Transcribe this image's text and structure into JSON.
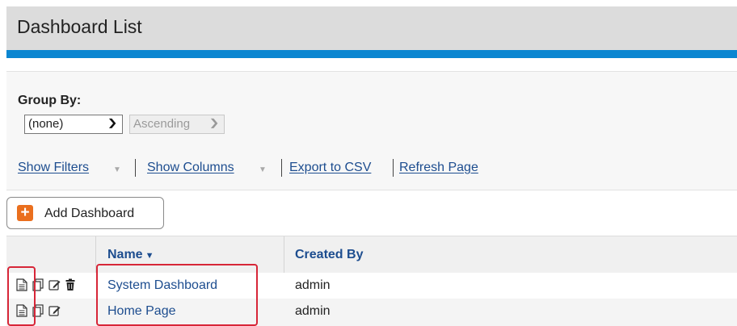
{
  "page": {
    "title": "Dashboard List"
  },
  "filters": {
    "group_by_label": "Group By:",
    "group_by_value": "(none)",
    "order_value": "Ascending"
  },
  "actions": {
    "show_filters": "Show Filters",
    "show_columns": "Show Columns",
    "export_csv": "Export to CSV",
    "refresh_page": "Refresh Page"
  },
  "add_button": {
    "label": "Add Dashboard"
  },
  "table": {
    "columns": [
      "Name",
      "Created By"
    ],
    "rows": [
      {
        "name": "System Dashboard",
        "created_by": "admin",
        "icons": [
          "view-icon",
          "copy-icon",
          "edit-icon",
          "delete-icon"
        ]
      },
      {
        "name": "Home Page",
        "created_by": "admin",
        "icons": [
          "view-icon",
          "copy-icon",
          "edit-icon"
        ]
      }
    ]
  },
  "colors": {
    "header_bg": "#dcdcdc",
    "accent_bar": "#0b86d1",
    "link": "#1d4d8f",
    "add_icon": "#ea6f1e",
    "highlight_box": "#d72638"
  }
}
